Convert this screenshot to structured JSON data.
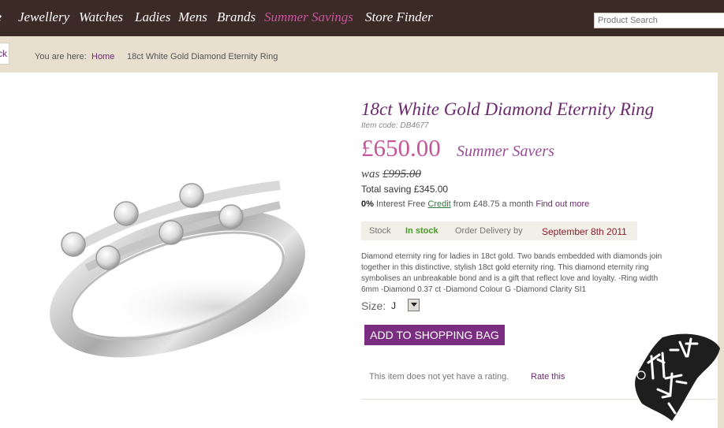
{
  "nav": {
    "items": [
      "ne",
      "Jewellery",
      "Watches",
      "Ladies",
      "Mens",
      "Brands",
      "Summer Savings",
      "Store Finder"
    ],
    "search_placeholder": "Product Search"
  },
  "breadcrumb": {
    "back_label": "ck",
    "prefix": "You are here:",
    "home": "Home",
    "current": "18ct White Gold Diamond Eternity Ring"
  },
  "product": {
    "title": "18ct White Gold Diamond Eternity Ring",
    "item_code": "Item code: DB4677",
    "price": "£650.00",
    "price_label": "Summer Savers",
    "was_label": "was",
    "was_price": "£995.00",
    "saving": "Total saving £345.00",
    "finance": {
      "rate": "0%",
      "interest_text": "Interest Free",
      "credit": "Credit",
      "from_text": "from £48.75 a month",
      "more": "Find out more"
    },
    "stock": {
      "label": "Stock",
      "status": "In stock",
      "delivery_label": "Order Delivery by",
      "delivery_date": "September 8th 2011"
    },
    "description": "Diamond eternity ring for ladies in 18ct gold. Two bands embedded with diamonds join together in this distinctive, stylish 18ct gold eternity ring. This diamond eternity ring symbolises an unbreakable bond and is a gift that reflect love and loyalty. -Ring width 6mm -Diamond 0.37 ct -Diamond Colour G -Diamond Clarity SI1",
    "size_label": "Size:",
    "size_value": "J",
    "add_to_bag": "ADD TO SHOPPING BAG",
    "rating_text": "This item does not yet have a rating.",
    "rate_this": "Rate this"
  },
  "colors": {
    "nav_bg": "#3b2a25",
    "accent_pink": "#c4569a",
    "brand_purple": "#6b2a6e",
    "button_purple": "#7b2d82",
    "in_stock_green": "#4a9a2c",
    "delivery_red": "#8b1e2a"
  }
}
